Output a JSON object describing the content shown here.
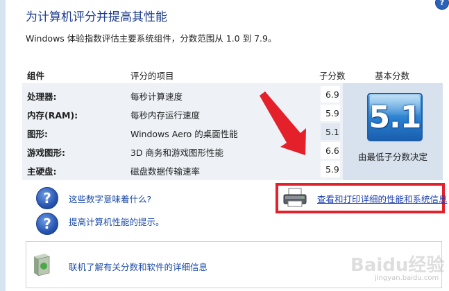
{
  "title": "为计算机评分并提高其性能",
  "subtitle": "Windows 体验指数评估主要系统组件，分数范围从 1.0 到 7.9。",
  "table": {
    "headers": {
      "component": "组件",
      "item": "评分的项目",
      "subscore": "子分数",
      "base": "基本分数"
    },
    "rows": [
      {
        "component": "处理器:",
        "item": "每秒计算速度",
        "subscore": "6.9"
      },
      {
        "component": "内存(RAM):",
        "item": "每秒内存运行速度",
        "subscore": "5.9"
      },
      {
        "component": "图形:",
        "item": "Windows Aero 的桌面性能",
        "subscore": "5.1"
      },
      {
        "component": "游戏图形:",
        "item": "3D 商务和游戏图形性能",
        "subscore": "6.6"
      },
      {
        "component": "主硬盘:",
        "item": "磁盘数据传输速率",
        "subscore": "5.9"
      }
    ],
    "base_score": "5.1",
    "base_caption": "由最低子分数决定"
  },
  "links": {
    "meaning": "这些数字意味着什么?",
    "tips": "提高计算机性能的提示。",
    "print": "查看和打印详细的性能和系统信息",
    "online": "联机了解有关分数和软件的详细信息"
  },
  "watermark": {
    "main": "Baidu经验",
    "sub": "jingyan.baidu.com"
  },
  "icons": {
    "help": "help-icon",
    "question": "question-circle-icon",
    "printer": "printer-icon",
    "software_box": "software-box-icon",
    "annotation": "red-arrow-annotation"
  },
  "colors": {
    "title": "#1c3b8f",
    "link": "#1b4aa8",
    "annotation_red": "#e4202a",
    "score_badge": "#2a7fcf"
  }
}
